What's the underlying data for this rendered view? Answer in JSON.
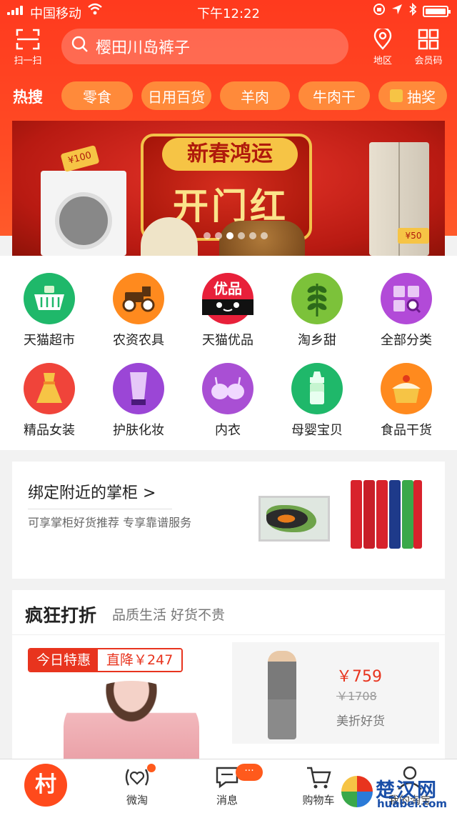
{
  "status_bar": {
    "carrier": "中国移动",
    "time": "下午12:22"
  },
  "header": {
    "scan_label": "扫一扫",
    "search_placeholder": "樱田川岛裤子",
    "region_label": "地区",
    "member_code_label": "会员码"
  },
  "hot_search": {
    "label": "热搜",
    "items": [
      "零食",
      "日用百货",
      "羊肉",
      "牛肉干",
      "抽奖"
    ]
  },
  "banner": {
    "headline": "新春鸿运",
    "subhead": "开门红",
    "tag_left": "¥100",
    "tag_right": "¥50"
  },
  "categories": [
    {
      "label": "天猫超市",
      "icon": "basket-icon",
      "color": "#1fb86a"
    },
    {
      "label": "农资农具",
      "icon": "tractor-icon",
      "color": "#ff8a1e"
    },
    {
      "label": "天猫优品",
      "icon": "tmall-icon",
      "color": "#e8203a",
      "badge": "优品"
    },
    {
      "label": "淘乡甜",
      "icon": "wheat-icon",
      "color": "#7cc23a"
    },
    {
      "label": "全部分类",
      "icon": "category-search-icon",
      "color": "#b24ad8"
    },
    {
      "label": "精品女装",
      "icon": "dress-icon",
      "color": "#f0443a"
    },
    {
      "label": "护肤化妆",
      "icon": "lotion-icon",
      "color": "#9b46d6"
    },
    {
      "label": "内衣",
      "icon": "bra-icon",
      "color": "#a94fd4"
    },
    {
      "label": "母婴宝贝",
      "icon": "baby-bottle-icon",
      "color": "#1fb86a"
    },
    {
      "label": "食品干货",
      "icon": "cake-icon",
      "color": "#ff8a1e"
    }
  ],
  "shop_card": {
    "title": "绑定附近的掌柜 >",
    "subtitle": "可享掌柜好货推荐 专享靠谱服务"
  },
  "discount": {
    "title": "疯狂打折",
    "subtitle": "品质生活 好货不贵",
    "left_badge": "今日特惠",
    "left_drop": "直降￥247",
    "right_price": "￥759",
    "right_old_price": "￥1708",
    "right_tag": "美折好货"
  },
  "tabbar": {
    "home_label": "村",
    "items": [
      "微淘",
      "消息",
      "购物车",
      "我的淘宝"
    ],
    "message_badge": "···"
  },
  "watermark": {
    "title": "楚汉网",
    "url": "huabei.com"
  },
  "colors": {
    "brand": "#ff4a1c",
    "accent_red": "#e8341e"
  }
}
